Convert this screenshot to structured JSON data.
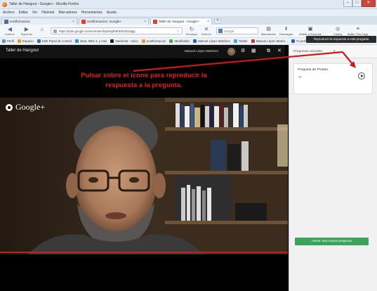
{
  "window": {
    "title": "Taller de Hangout - Google+ - Mozilla Firefox",
    "controls": [
      "–",
      "□",
      "✕"
    ]
  },
  "menu": [
    "Archivo",
    "Editar",
    "Ver",
    "Historial",
    "Marcadores",
    "Herramientas",
    "Ayuda"
  ],
  "tabs": [
    {
      "label": "eLMformacion",
      "active": false
    },
    {
      "label": "eLMformacion: Google+",
      "active": false
    },
    {
      "label": "Taller de Hangout - Google+",
      "active": true
    }
  ],
  "new_tab": "+",
  "navbar": {
    "back": "Anterior",
    "forward": "Siguiente",
    "url": "https://plus.google.com/events/cbqh4njdh9hb4h4b16jpg",
    "reload": "Recargar",
    "stop": "Detener",
    "search_placeholder": "Google",
    "tools": [
      "Marcadores",
      "Descargas",
      "Añadir a Evernote",
      "Clearly",
      "Buffer This Page"
    ]
  },
  "bookmarks": [
    "Perfil",
    "Espacio",
    "SSE Panel de Control",
    "Beta, BBX 3, y más",
    "Nerberita - Inicio",
    "eLMformacion",
    "Mindfulube",
    "Manuel López Martínez",
    "Twitter",
    "Manuel López Martín...",
    "Tu perfil | LinkedIn"
  ],
  "hangout": {
    "title": "Taller de Hangout",
    "user_name": "Manuel López Martínez",
    "instruction_line1": "Pulsar sobre el icono para reproducir la",
    "instruction_line2": "respuesta a la pregunta.",
    "google_plus_label": "Google+"
  },
  "panel": {
    "header": "Preguntas actuales",
    "question_title": "Pregunta de Prueba",
    "question_count": "+0",
    "tooltip": "Reproducir la respuesta a esta pregunta",
    "new_question_button": "Hacer una nueva pregunta"
  },
  "colors": {
    "instruction": "#e01e1e",
    "arrow": "#d01818",
    "new_question": "#3aa45a"
  }
}
